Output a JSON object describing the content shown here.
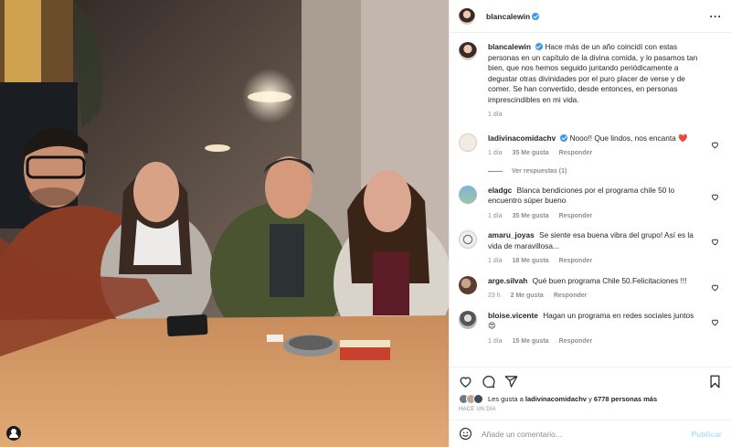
{
  "post": {
    "username": "blancalewin",
    "caption": "Hace más de un año coincidí con estas personas en un capítulo de la divina comida, y lo pasamos tan bien, que nos hemos seguido juntando periódicamente a degustar otras divinidades por el puro placer de verse y de comer. Se han convertido, desde entonces, en personas imprescindibles en mi vida.",
    "caption_time": "1 día"
  },
  "comments": [
    {
      "user": "ladivinacomidachv",
      "verified": true,
      "text": "Nooo!! Que lindos, nos encanta ❤️",
      "time": "1 día",
      "likes": "35 Me gusta",
      "reply": "Responder"
    },
    {
      "user": "eladgc",
      "text": "Blanca bendiciones por el programa chile 50 lo encuentro súper bueno",
      "time": "1 día",
      "likes": "35 Me gusta",
      "reply": "Responder"
    },
    {
      "user": "amaru_joyas",
      "text": "Se siente esa buena vibra del grupo! Así es la vida de maravillosa...",
      "time": "1 día",
      "likes": "18 Me gusta",
      "reply": "Responder"
    },
    {
      "user": "arge.silvah",
      "text": "Qué buen programa Chile 50.Felicitaciones !!!",
      "time": "23 h",
      "likes": "2 Me gusta",
      "reply": "Responder"
    },
    {
      "user": "bloise.vicente",
      "text": "Hagan un programa en redes sociales juntos 😍",
      "time": "1 día",
      "likes": "15 Me gusta",
      "reply": "Responder"
    }
  ],
  "view_replies": "Ver respuestas (1)",
  "likes": {
    "prefix": "Les gusta a",
    "user": "ladivinacomidachv",
    "joiner": "y",
    "count": "6778 personas más"
  },
  "posted_ago": "HACE UN DÍA",
  "composer": {
    "placeholder": "Añade un comentario...",
    "publish": "Publicar"
  },
  "icons": {
    "more": "more-options-icon",
    "like": "heart-outline-icon",
    "comment": "comment-bubble-icon",
    "share": "paper-plane-icon",
    "save": "bookmark-icon",
    "emoji": "emoji-smiley-icon",
    "user_tag": "user-tag-icon"
  },
  "colors": {
    "verified": "#3897f0",
    "muted": "#8e8e8e",
    "publish_disabled": "#b2dffc",
    "heart_red": "#ed4956"
  }
}
